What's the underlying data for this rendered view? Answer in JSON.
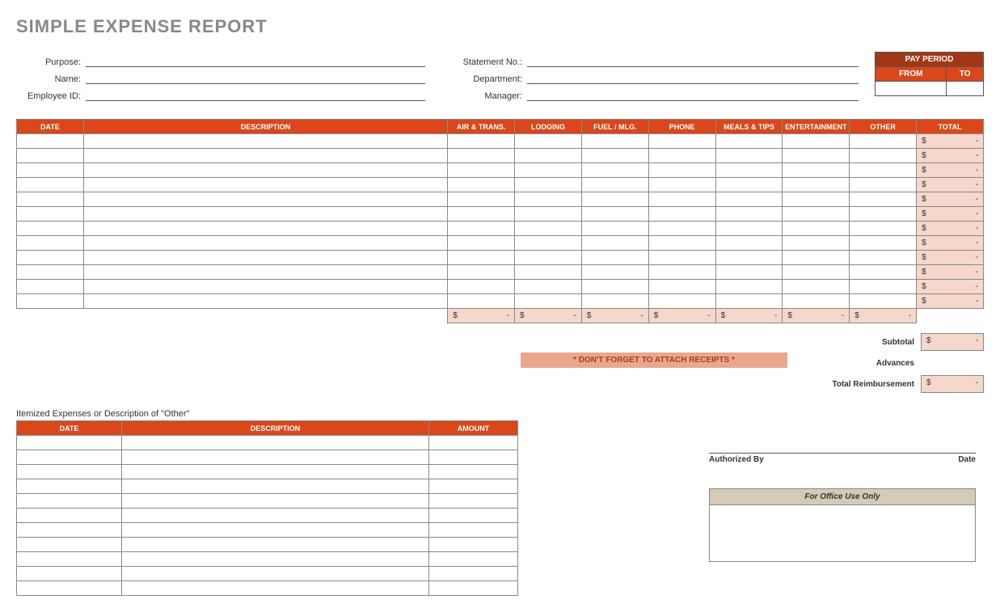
{
  "title": "SIMPLE EXPENSE REPORT",
  "header": {
    "left": {
      "purpose_label": "Purpose:",
      "purpose_value": "",
      "name_label": "Name:",
      "name_value": "",
      "empid_label": "Employee ID:",
      "empid_value": ""
    },
    "right": {
      "stmt_label": "Statement No.:",
      "stmt_value": "",
      "dept_label": "Department:",
      "dept_value": "",
      "mgr_label": "Manager:",
      "mgr_value": ""
    }
  },
  "pay_period": {
    "title": "PAY PERIOD",
    "from_label": "FROM",
    "to_label": "TO",
    "from_value": "",
    "to_value": ""
  },
  "columns": {
    "date": "DATE",
    "desc": "DESCRIPTION",
    "air": "AIR & TRANS.",
    "lodging": "LODGING",
    "fuel": "FUEL / MLG.",
    "phone": "PHONE",
    "meals": "MEALS & TIPS",
    "ent": "ENTERTAINMENT",
    "other": "OTHER",
    "total": "TOTAL"
  },
  "currency_symbol": "$",
  "dash": "-",
  "row_count": 12,
  "reminder": "* DON'T FORGET TO ATTACH RECEIPTS *",
  "totals": {
    "subtotal_label": "Subtotal",
    "subtotal_value": "-",
    "advances_label": "Advances",
    "advances_value": "",
    "reimb_label": "Total Reimbursement",
    "reimb_value": "-"
  },
  "other_section": {
    "heading": "Itemized Expenses or Description of \"Other\"",
    "columns": {
      "date": "DATE",
      "desc": "DESCRIPTION",
      "amt": "AMOUNT"
    },
    "row_count": 11
  },
  "signature": {
    "auth_label": "Authorized By",
    "date_label": "Date"
  },
  "office": {
    "heading": "For Office Use Only"
  }
}
